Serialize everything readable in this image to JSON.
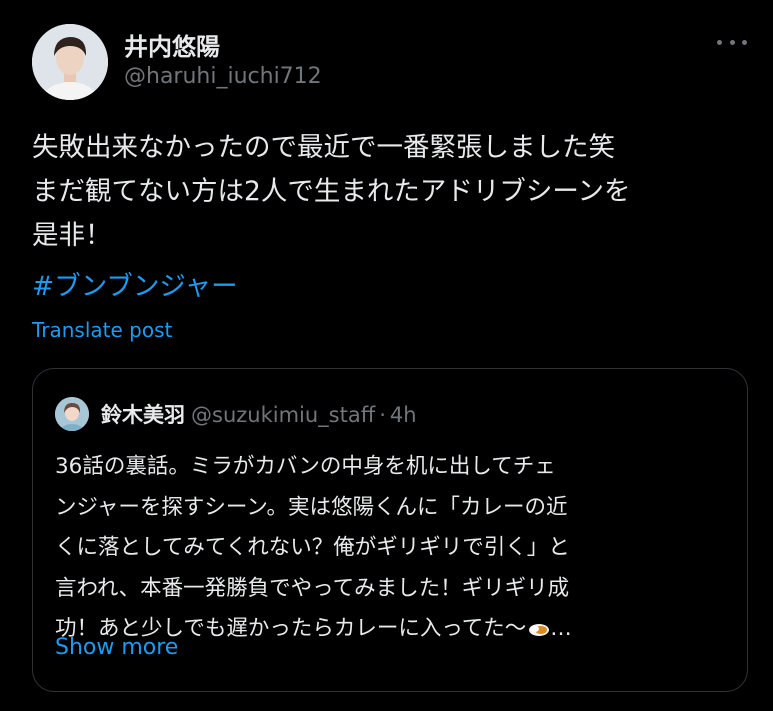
{
  "post": {
    "author": {
      "name": "井内悠陽",
      "handle": "@haruhi_iuchi712"
    },
    "more_icon": "more-horizontal-icon",
    "text_lines": [
      "失敗出来なかったので最近で一番緊張しました笑",
      "まだ観てない方は2人で生まれたアドリブシーンを",
      "是非！"
    ],
    "hashtag": "#ブンブンジャー",
    "translate_label": "Translate post"
  },
  "quote": {
    "author": {
      "name": "鈴木美羽",
      "handle": "@suzukimiu_staff",
      "separator": "·",
      "time": "4h"
    },
    "text_lines": [
      "36話の裏話。ミラがカバンの中身を机に出してチェ",
      "ンジャーを探すシーン。実は悠陽くんに「カレーの近",
      "くに落としてみてくれない？俺がギリギリで引く」と",
      "言われ、本番一発勝負でやってみました！ギリギリ成",
      "功！あと少しでも遅かったらカレーに入ってた〜"
    ],
    "trailing_icon": "curry-rice-emoji",
    "ellipsis": "…",
    "show_more_label": "Show more"
  },
  "colors": {
    "background": "#000000",
    "primary_text": "#e7e9ea",
    "secondary_text": "#71767b",
    "accent": "#1d9bf0",
    "border": "#2f3336"
  }
}
